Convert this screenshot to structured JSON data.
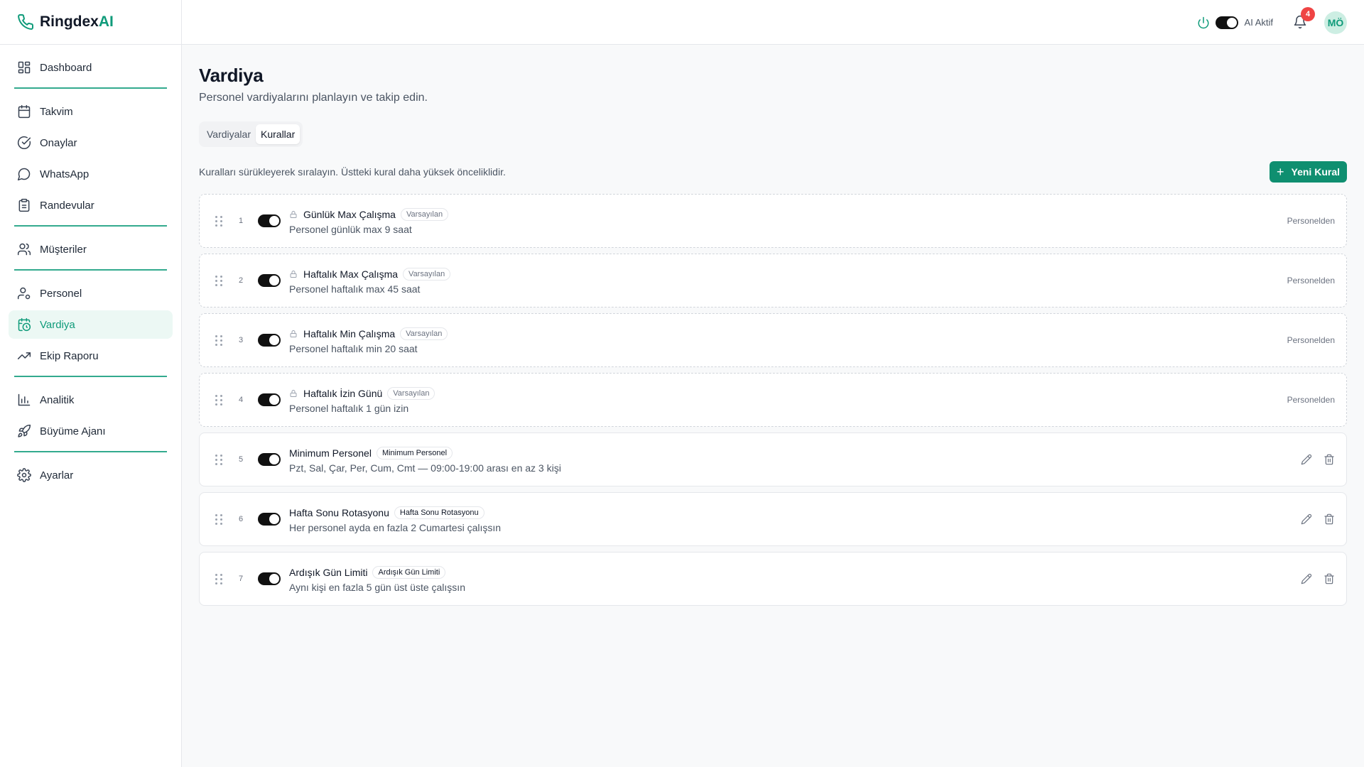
{
  "app": {
    "name_part1": "Ringdex",
    "name_part2": "AI",
    "accent": "#0f9b7a"
  },
  "sidebar": {
    "items": [
      {
        "label": "Dashboard",
        "icon": "grid-icon"
      },
      {
        "label": "Takvim",
        "icon": "calendar-icon"
      },
      {
        "label": "Onaylar",
        "icon": "check-circle-icon"
      },
      {
        "label": "WhatsApp",
        "icon": "chat-icon"
      },
      {
        "label": "Randevular",
        "icon": "clipboard-icon"
      },
      {
        "label": "Müşteriler",
        "icon": "users-icon"
      },
      {
        "label": "Personel",
        "icon": "user-cog-icon"
      },
      {
        "label": "Vardiya",
        "icon": "calendar-clock-icon",
        "active": true
      },
      {
        "label": "Ekip Raporu",
        "icon": "trending-up-icon"
      },
      {
        "label": "Analitik",
        "icon": "bar-chart-icon"
      },
      {
        "label": "Büyüme Ajanı",
        "icon": "rocket-icon"
      },
      {
        "label": "Ayarlar",
        "icon": "gear-icon"
      }
    ]
  },
  "topbar": {
    "ai_label": "AI Aktif",
    "notif_count": "4",
    "avatar": "MÖ"
  },
  "page": {
    "title": "Vardiya",
    "subtitle": "Personel vardiyalarını planlayın ve takip edin.",
    "tabs": [
      "Vardiyalar",
      "Kurallar"
    ],
    "active_tab": "Kurallar",
    "hint": "Kuralları sürükleyerek sıralayın. Üstteki kural daha yüksek önceliklidir.",
    "new_button": "Yeni Kural"
  },
  "rules": [
    {
      "num": "1",
      "name": "Günlük Max Çalışma",
      "badge": "Varsayılan",
      "desc": "Personel günlük max 9 saat",
      "source": "Personelden"
    },
    {
      "num": "2",
      "name": "Haftalık Max Çalışma",
      "badge": "Varsayılan",
      "desc": "Personel haftalık max 45 saat",
      "source": "Personelden"
    },
    {
      "num": "3",
      "name": "Haftalık Min Çalışma",
      "badge": "Varsayılan",
      "desc": "Personel haftalık min 20 saat",
      "source": "Personelden"
    },
    {
      "num": "4",
      "name": "Haftalık İzin Günü",
      "badge": "Varsayılan",
      "desc": "Personel haftalık 1 gün izin",
      "source": "Personelden"
    },
    {
      "num": "5",
      "name": "Minimum Personel",
      "badge": "Minimum Personel",
      "desc": "Pzt, Sal, Çar, Per, Cum, Cmt — 09:00-19:00 arası en az 3 kişi"
    },
    {
      "num": "6",
      "name": "Hafta Sonu Rotasyonu",
      "badge": "Hafta Sonu Rotasyonu",
      "desc": "Her personel ayda en fazla 2 Cumartesi çalışsın"
    },
    {
      "num": "7",
      "name": "Ardışık Gün Limiti",
      "badge": "Ardışık Gün Limiti",
      "desc": "Aynı kişi en fazla 5 gün üst üste çalışsın"
    }
  ]
}
